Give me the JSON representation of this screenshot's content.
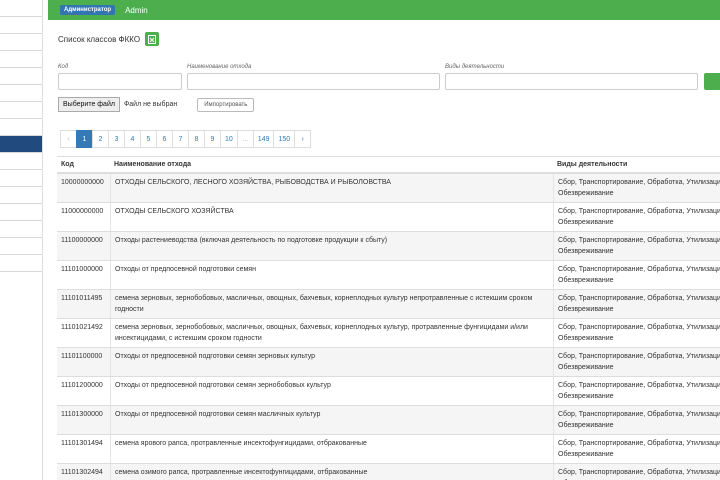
{
  "header": {
    "role_badge": "Администратор",
    "user_name": "Admin"
  },
  "page": {
    "title": "Список классов ФККО",
    "filters": {
      "code_label": "Код",
      "name_label": "Наименование отхода",
      "activity_label": "Виды деятельности"
    },
    "file_button": "Выберите файл",
    "file_status": "Файл не выбран",
    "import_button": "Импортировать"
  },
  "pagination": {
    "prev": "‹",
    "pages": [
      "1",
      "2",
      "3",
      "4",
      "5",
      "6",
      "7",
      "8",
      "9",
      "10",
      "...",
      "149",
      "150"
    ],
    "current": "1",
    "next": "›"
  },
  "table": {
    "headers": [
      "Код",
      "Наименование отхода",
      "Виды деятельности"
    ],
    "rows": [
      {
        "code": "10000000000",
        "name": "ОТХОДЫ СЕЛЬСКОГО, ЛЕСНОГО ХОЗЯЙСТВА, РЫБОВОДСТВА И РЫБОЛОВСТВА",
        "activities": "Сбор, Транспортирование, Обработка, Утилизация, Обезвреживание"
      },
      {
        "code": "11000000000",
        "name": "ОТХОДЫ СЕЛЬСКОГО ХОЗЯЙСТВА",
        "activities": "Сбор, Транспортирование, Обработка, Утилизация, Обезвреживание"
      },
      {
        "code": "11100000000",
        "name": "Отходы растениеводства (включая деятельность по подготовке продукции к сбыту)",
        "activities": "Сбор, Транспортирование, Обработка, Утилизация, Обезвреживание"
      },
      {
        "code": "11101000000",
        "name": "Отходы от предпосевной подготовки семян",
        "activities": "Сбор, Транспортирование, Обработка, Утилизация, Обезвреживание"
      },
      {
        "code": "11101011495",
        "name": "семена зерновых, зернобобовых, масличных, овощных, бахчевых, корнеплодных культур непротравленные с истекшим сроком годности",
        "activities": "Сбор, Транспортирование, Обработка, Утилизация, Обезвреживание"
      },
      {
        "code": "11101021492",
        "name": "семена зерновых, зернобобовых, масличных, овощных, бахчевых, корнеплодных культур, протравленные фунгицидами и/или инсектицидами, с истекшим сроком годности",
        "activities": "Сбор, Транспортирование, Обработка, Утилизация, Обезвреживание"
      },
      {
        "code": "11101100000",
        "name": "Отходы от предпосевной подготовки семян зерновых культур",
        "activities": "Сбор, Транспортирование, Обработка, Утилизация, Обезвреживание"
      },
      {
        "code": "11101200000",
        "name": "Отходы от предпосевной подготовки семян зернобобовых культур",
        "activities": "Сбор, Транспортирование, Обработка, Утилизация, Обезвреживание"
      },
      {
        "code": "11101300000",
        "name": "Отходы от предпосевной подготовки семян масличных культур",
        "activities": "Сбор, Транспортирование, Обработка, Утилизация, Обезвреживание"
      },
      {
        "code": "11101301494",
        "name": "семена ярового рапса, протравленные инсектофунгицидами, отбракованные",
        "activities": "Сбор, Транспортирование, Обработка, Утилизация, Обезвреживание"
      },
      {
        "code": "11101302494",
        "name": "семена озимого рапса, протравленные инсектофунгицидами, отбракованные",
        "activities": "Сбор, Транспортирование, Обработка, Утилизация, Обезвреживание"
      }
    ]
  },
  "colors": {
    "accent_green": "#4cae4c",
    "primary_blue": "#337ab7",
    "sidebar_active": "#214a7e"
  }
}
